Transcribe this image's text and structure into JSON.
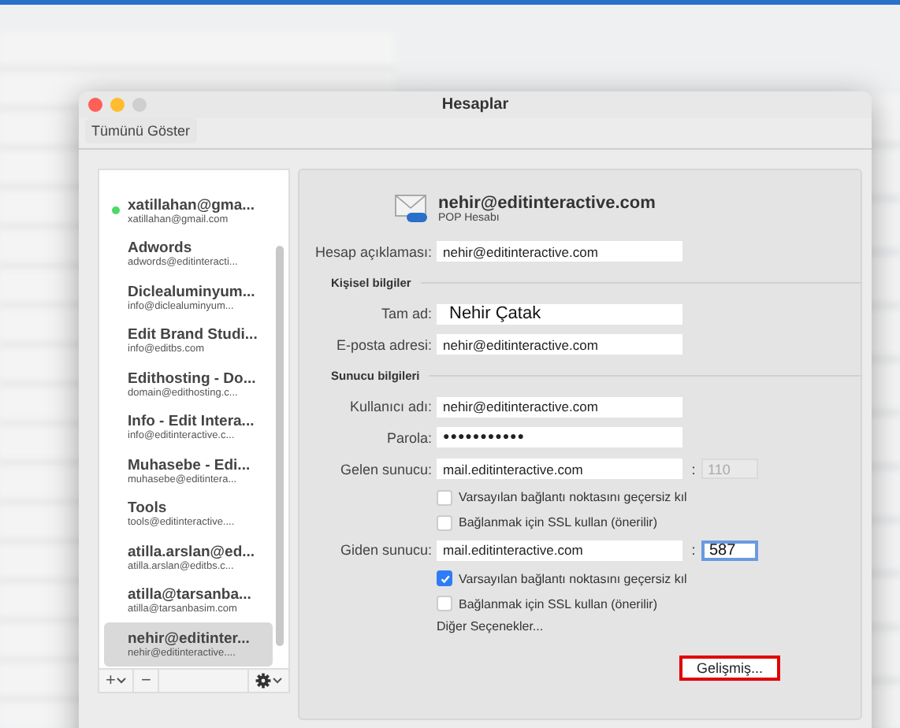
{
  "window": {
    "title": "Hesaplar"
  },
  "toolbar": {
    "show_all_button": "Tümünü Göster"
  },
  "accounts": [
    {
      "name": "xatillahan@gma...",
      "email": "xatillahan@gmail.com",
      "online": true,
      "selected": false
    },
    {
      "name": "Adwords",
      "email": "adwords@editinteracti...",
      "online": false,
      "selected": false
    },
    {
      "name": "Diclealuminyum...",
      "email": "info@diclealuminyum...",
      "online": false,
      "selected": false
    },
    {
      "name": "Edit Brand Studi...",
      "email": "info@editbs.com",
      "online": false,
      "selected": false
    },
    {
      "name": "Edithosting - Do...",
      "email": "domain@edithosting.c...",
      "online": false,
      "selected": false
    },
    {
      "name": "Info - Edit Intera...",
      "email": "info@editinteractive.c...",
      "online": false,
      "selected": false
    },
    {
      "name": "Muhasebe - Edi...",
      "email": "muhasebe@editintera...",
      "online": false,
      "selected": false
    },
    {
      "name": "Tools",
      "email": "tools@editinteractive....",
      "online": false,
      "selected": false
    },
    {
      "name": "atilla.arslan@ed...",
      "email": "atilla.arslan@editbs.c...",
      "online": false,
      "selected": false
    },
    {
      "name": "atilla@tarsanba...",
      "email": "atilla@tarsanbasim.com",
      "online": false,
      "selected": false
    },
    {
      "name": "nehir@editinter...",
      "email": "nehir@editinteractive....",
      "online": false,
      "selected": true
    }
  ],
  "list_toolbar": {
    "add_button": "+",
    "remove_button": "−"
  },
  "account": {
    "email": "nehir@editinteractive.com",
    "type": "POP Hesabı"
  },
  "rows": [
    {
      "kind": "field",
      "label": "Hesap açıklaması:",
      "value": "nehir@editinteractive.com",
      "large": false
    },
    {
      "kind": "section",
      "label": "Kişisel bilgiler"
    },
    {
      "kind": "field",
      "label": "Tam ad:",
      "value": "Nehir Çatak",
      "large": true
    },
    {
      "kind": "field",
      "label": "E-posta adresi:",
      "value": "nehir@editinteractive.com",
      "large": false
    },
    {
      "kind": "section",
      "label": "Sunucu bilgileri"
    },
    {
      "kind": "field",
      "label": "Kullanıcı adı:",
      "value": "nehir@editinteractive.com",
      "large": false
    },
    {
      "kind": "password",
      "label": "Parola:",
      "value": "●●●●●●●●●●●"
    },
    {
      "kind": "server",
      "label": "Gelen sunucu:",
      "value": "mail.editinteractive.com",
      "separator": ":",
      "port": "110",
      "port_disabled": true,
      "port_focused": false
    },
    {
      "kind": "checkbox",
      "label": "Varsayılan bağlantı noktasını geçersiz kıl",
      "checked": false
    },
    {
      "kind": "checkbox",
      "label": "Bağlanmak için SSL kullan (önerilir)",
      "checked": false
    },
    {
      "kind": "server",
      "label": "Giden sunucu:",
      "value": "mail.editinteractive.com",
      "separator": ":",
      "port": "587",
      "port_disabled": false,
      "port_focused": true
    },
    {
      "kind": "checkbox",
      "label": "Varsayılan bağlantı noktasını geçersiz kıl",
      "checked": true
    },
    {
      "kind": "checkbox",
      "label": "Bağlanmak için SSL kullan (önerilir)",
      "checked": false
    },
    {
      "kind": "link",
      "label": "Diğer Seçenekler..."
    }
  ],
  "advanced_button": {
    "label": "Gelişmiş...",
    "highlighted": true
  }
}
